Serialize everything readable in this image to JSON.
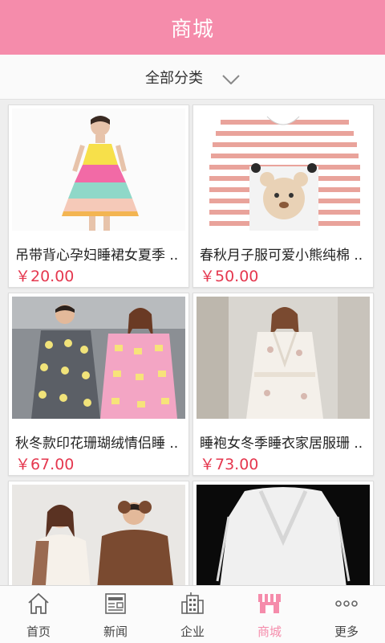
{
  "header": {
    "title": "商城"
  },
  "filter": {
    "label": "全部分类",
    "icon": "chevron-down-icon"
  },
  "products": [
    {
      "title": "吊带背心孕妇睡裙女夏季 ..",
      "price": "￥20.00"
    },
    {
      "title": "春秋月子服可爱小熊纯棉 ..",
      "price": "￥50.00"
    },
    {
      "title": "秋冬款印花珊瑚绒情侣睡 ..",
      "price": "￥67.00"
    },
    {
      "title": "睡袍女冬季睡衣家居服珊 ..",
      "price": "￥73.00"
    },
    {
      "title": "",
      "price": ""
    },
    {
      "title": "",
      "price": ""
    }
  ],
  "tabbar": {
    "active_color": "#f58cab",
    "items": [
      {
        "label": "首页",
        "icon": "home-icon"
      },
      {
        "label": "新闻",
        "icon": "news-icon"
      },
      {
        "label": "企业",
        "icon": "building-icon"
      },
      {
        "label": "商城",
        "icon": "shop-icon",
        "active": true
      },
      {
        "label": "更多",
        "icon": "more-icon"
      }
    ]
  },
  "colors": {
    "brand": "#f58cab",
    "price": "#e5384f"
  }
}
